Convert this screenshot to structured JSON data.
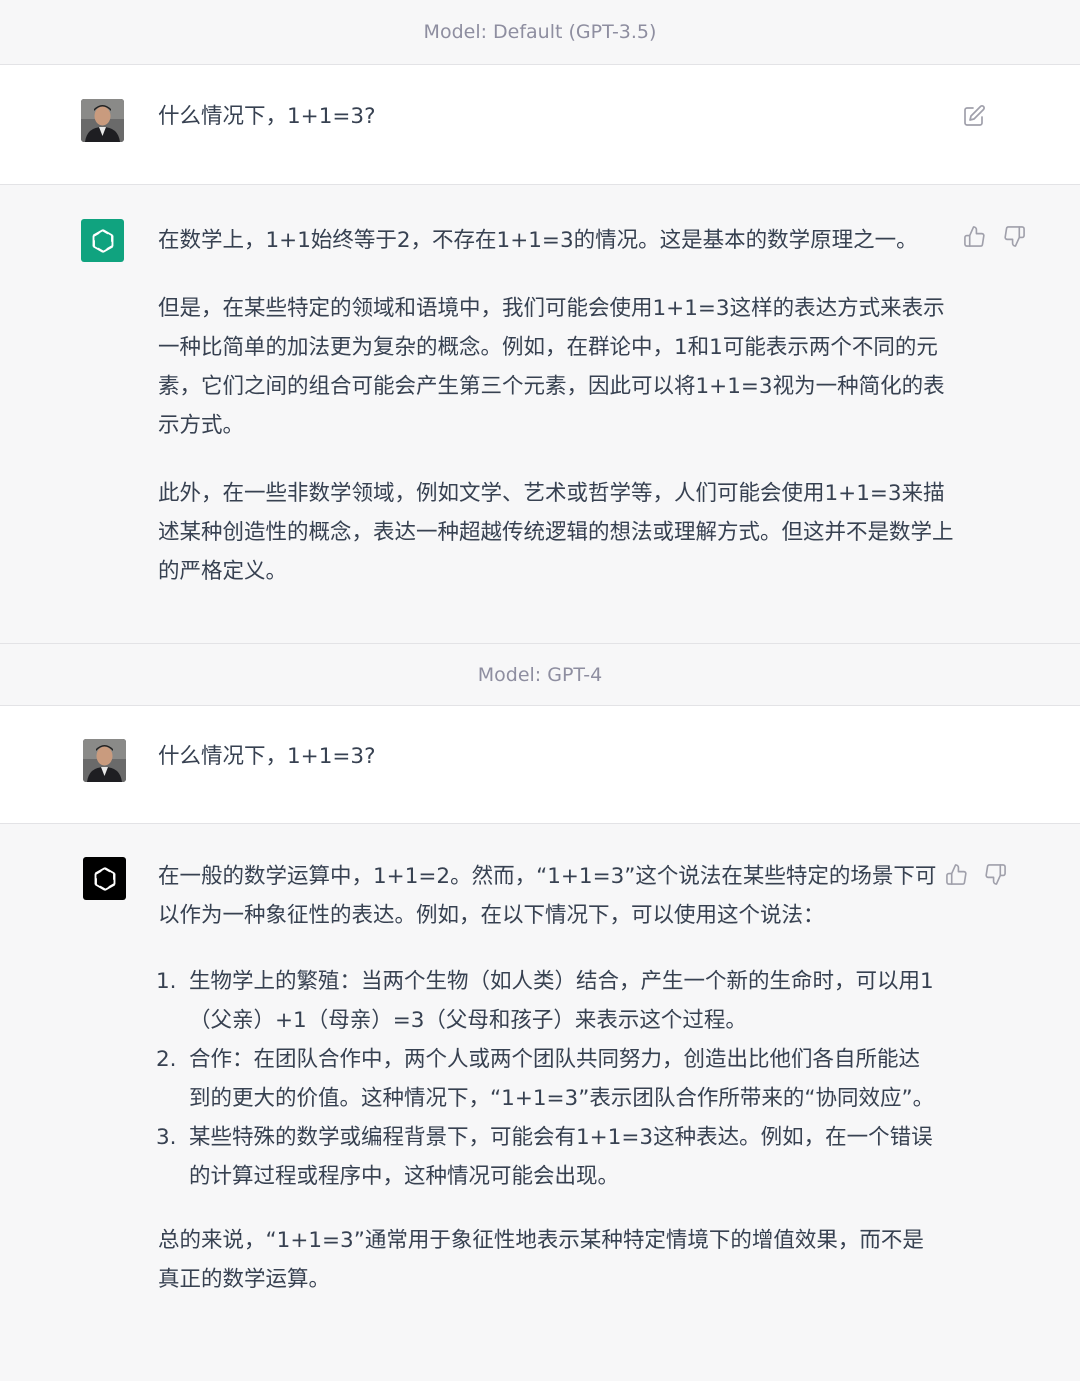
{
  "sections": [
    {
      "model_label": "Model: Default (GPT-3.5)",
      "user_message": "什么情况下，1+1=3?",
      "assistant_paragraphs": [
        "在数学上，1+1始终等于2，不存在1+1=3的情况。这是基本的数学原理之一。",
        "但是，在某些特定的领域和语境中，我们可能会使用1+1=3这样的表达方式来表示一种比简单的加法更为复杂的概念。例如，在群论中，1和1可能表示两个不同的元素，它们之间的组合可能会产生第三个元素，因此可以将1+1=3视为一种简化的表示方式。",
        "此外，在一些非数学领域，例如文学、艺术或哲学等，人们可能会使用1+1=3来描述某种创造性的概念，表达一种超越传统逻辑的想法或理解方式。但这并不是数学上的严格定义。"
      ]
    },
    {
      "model_label": "Model: GPT-4",
      "user_message": "什么情况下，1+1=3?",
      "assistant_intro": "在一般的数学运算中，1+1=2。然而，“1+1=3”这个说法在某些特定的场景下可以作为一种象征性的表达。例如，在以下情况下，可以使用这个说法：",
      "assistant_list": [
        {
          "num": "1.",
          "text": "生物学上的繁殖：当两个生物（如人类）结合，产生一个新的生命时，可以用1（父亲）+1（母亲）=3（父母和孩子）来表示这个过程。"
        },
        {
          "num": "2.",
          "text": "合作：在团队合作中，两个人或两个团队共同努力，创造出比他们各自所能达到的更大的价值。这种情况下，“1+1=3”表示团队合作所带来的“协同效应”。"
        },
        {
          "num": "3.",
          "text": "某些特殊的数学或编程背景下，可能会有1+1=3这种表达。例如，在一个错误的计算过程或程序中，这种情况可能会出现。"
        }
      ],
      "assistant_conclusion": "总的来说，“1+1=3”通常用于象征性地表示某种特定情境下的增值效果，而不是真正的数学运算。"
    }
  ],
  "icons": {
    "edit": "edit-icon",
    "thumbs_up": "thumbs-up-icon",
    "thumbs_down": "thumbs-down-icon",
    "openai_logo": "openai-logo-icon"
  },
  "colors": {
    "gpt35_avatar": "#10a37f",
    "gpt4_avatar": "#000000",
    "text": "#374151",
    "muted": "#8e8ea0"
  }
}
